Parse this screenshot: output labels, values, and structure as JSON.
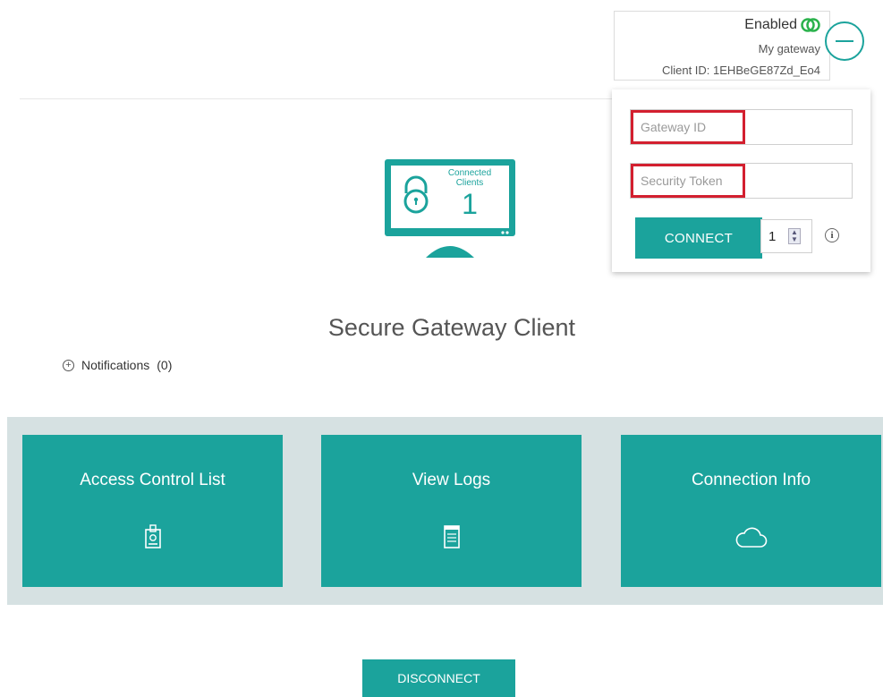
{
  "status": {
    "enabled_label": "Enabled",
    "gateway_name": "My gateway",
    "client_id": "Client ID: 1EHBeGE87Zd_Eo4",
    "enabled_color": "#2bb24c"
  },
  "connect_panel": {
    "gateway_id_placeholder": "Gateway ID",
    "security_token_placeholder": "Security Token",
    "connect_label": "CONNECT",
    "stepper_value": "1",
    "info_glyph": "i"
  },
  "monitor": {
    "label_line1": "Connected",
    "label_line2": "Clients",
    "count": "1"
  },
  "main": {
    "title": "Secure Gateway Client",
    "notifications_label": "Notifications",
    "notifications_count": "(0)"
  },
  "tiles": [
    {
      "label": "Access Control List",
      "icon": "id-badge-icon"
    },
    {
      "label": "View Logs",
      "icon": "document-icon"
    },
    {
      "label": "Connection Info",
      "icon": "cloud-icon"
    }
  ],
  "footer": {
    "disconnect_label": "DISCONNECT"
  },
  "colors": {
    "accent": "#1ba39c",
    "highlight": "#d31f2f",
    "band": "#d6e1e2"
  }
}
